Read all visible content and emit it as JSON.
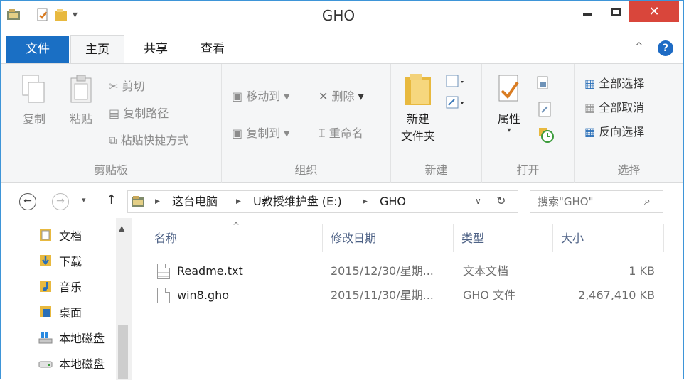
{
  "window": {
    "title": "GHO",
    "close_glyph": "✕"
  },
  "ribbon_tabs": [
    "文件",
    "主页",
    "共享",
    "查看"
  ],
  "ribbon": {
    "clipboard": {
      "copy": "复制",
      "paste": "粘贴",
      "cut": "剪切",
      "copy_path": "复制路径",
      "paste_shortcut": "粘贴快捷方式",
      "label": "剪贴板"
    },
    "organize": {
      "move_to": "移动到",
      "copy_to": "复制到",
      "delete": "删除",
      "rename": "重命名",
      "label": "组织"
    },
    "new": {
      "new_folder_line1": "新建",
      "new_folder_line2": "文件夹",
      "label": "新建"
    },
    "open": {
      "properties": "属性",
      "label": "打开"
    },
    "select": {
      "select_all": "全部选择",
      "select_none": "全部取消",
      "invert": "反向选择",
      "label": "选择"
    }
  },
  "address": {
    "crumbs": [
      "这台电脑",
      "U教授维护盘 (E:)",
      "GHO"
    ],
    "search_placeholder": "搜索\"GHO\""
  },
  "nav_items": [
    "文档",
    "下载",
    "音乐",
    "桌面",
    "本地磁盘",
    "本地磁盘"
  ],
  "columns": {
    "name": "名称",
    "date": "修改日期",
    "type": "类型",
    "size": "大小"
  },
  "files": [
    {
      "name": "Readme.txt",
      "date": "2015/12/30/星期...",
      "type": "文本文档",
      "size": "1 KB"
    },
    {
      "name": "win8.gho",
      "date": "2015/11/30/星期...",
      "type": "GHO 文件",
      "size": "2,467,410 KB"
    }
  ],
  "colors": {
    "accent": "#1a6fc4",
    "close": "#d9463b",
    "ribbon_bg": "#f5f6f7",
    "header_text": "#4d6185"
  }
}
